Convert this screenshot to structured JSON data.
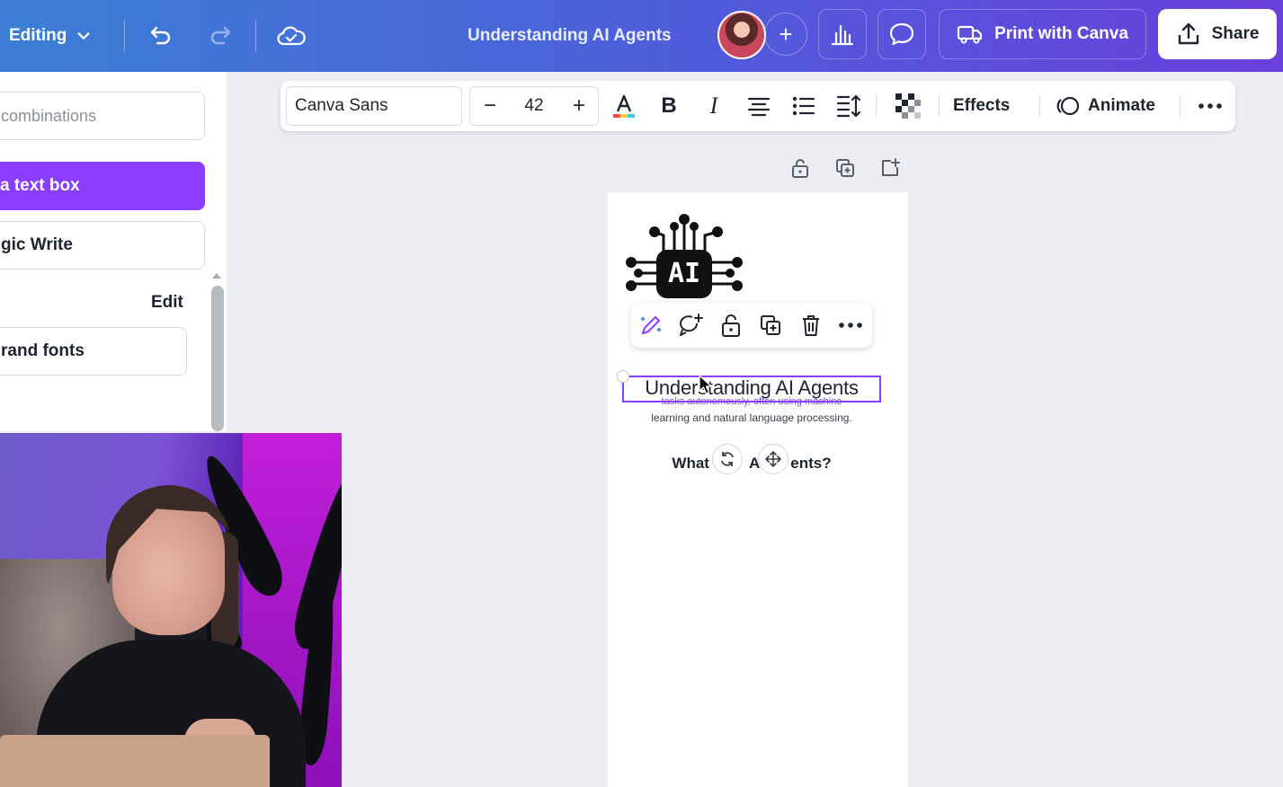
{
  "topbar": {
    "editing_label": "Editing",
    "doc_title": "Understanding AI Agents",
    "print_label": "Print with Canva",
    "share_label": "Share",
    "accent_start": "#3c7fd6",
    "accent_end": "#6a3fdc"
  },
  "left_panel": {
    "search_placeholder": "combinations",
    "add_text_label": "a text box",
    "magic_write_label": "gic Write",
    "edit_label": "Edit",
    "brand_fonts_label": "rand fonts",
    "primary_color": "#8b3dff"
  },
  "format_toolbar": {
    "font_name": "Canva Sans",
    "font_size": "42",
    "minus_label": "−",
    "plus_label": "+",
    "effects_label": "Effects",
    "animate_label": "Animate"
  },
  "canvas": {
    "logo_text": "AI",
    "title_text": "Understanding AI Agents",
    "body_ghost_text": "tasks autonomously, often using machine",
    "body_text": "learning and natural language processing.",
    "heading2_left": "What",
    "heading2_mid": "A",
    "heading2_right": "ents?"
  }
}
